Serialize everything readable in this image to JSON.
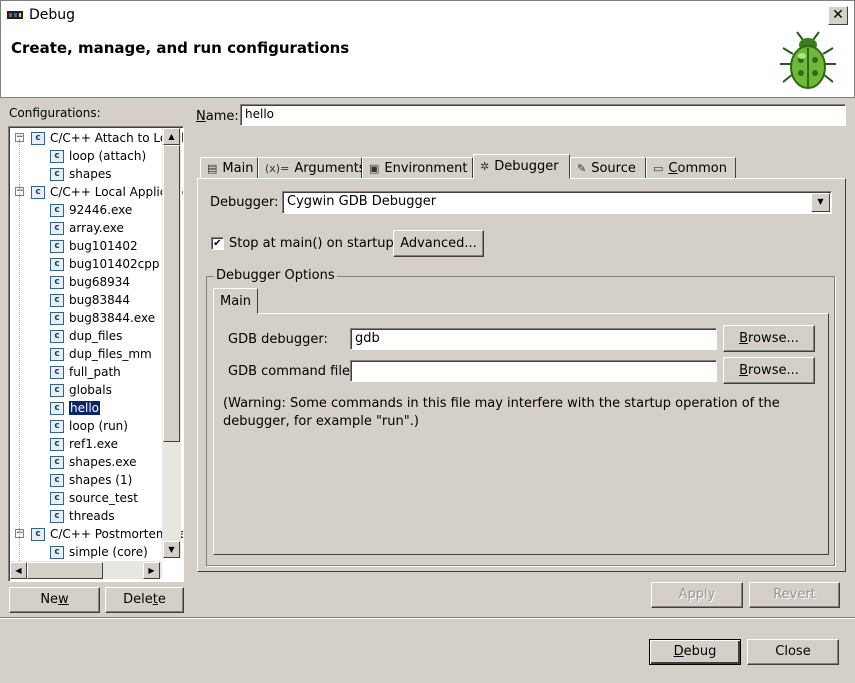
{
  "window": {
    "title": "Debug",
    "close_glyph": "✕"
  },
  "header": {
    "title": "Create, manage, and run configurations",
    "icon": "bug-icon"
  },
  "configurations": {
    "label": "Configurations:",
    "tree": [
      {
        "type": "group",
        "label": "C/C++ Attach to Local Application",
        "expanded": true
      },
      {
        "type": "item",
        "label": "loop (attach)"
      },
      {
        "type": "item",
        "label": "shapes"
      },
      {
        "type": "group",
        "label": "C/C++ Local Application",
        "expanded": true
      },
      {
        "type": "item",
        "label": "92446.exe"
      },
      {
        "type": "item",
        "label": "array.exe"
      },
      {
        "type": "item",
        "label": "bug101402"
      },
      {
        "type": "item",
        "label": "bug101402cpp"
      },
      {
        "type": "item",
        "label": "bug68934"
      },
      {
        "type": "item",
        "label": "bug83844"
      },
      {
        "type": "item",
        "label": "bug83844.exe"
      },
      {
        "type": "item",
        "label": "dup_files"
      },
      {
        "type": "item",
        "label": "dup_files_mm"
      },
      {
        "type": "item",
        "label": "full_path"
      },
      {
        "type": "item",
        "label": "globals"
      },
      {
        "type": "item",
        "label": "hello",
        "selected": true
      },
      {
        "type": "item",
        "label": "loop (run)"
      },
      {
        "type": "item",
        "label": "ref1.exe"
      },
      {
        "type": "item",
        "label": "shapes.exe"
      },
      {
        "type": "item",
        "label": "shapes (1)"
      },
      {
        "type": "item",
        "label": "source_test"
      },
      {
        "type": "item",
        "label": "threads"
      },
      {
        "type": "group",
        "label": "C/C++ Postmortem debugger",
        "expanded": true
      },
      {
        "type": "item",
        "label": "simple (core)"
      }
    ],
    "new_prefix": "Ne",
    "new_u": "w",
    "new_rest": "",
    "delete_prefix": "Dele",
    "delete_u": "t",
    "delete_rest": "e"
  },
  "name": {
    "label_u": "N",
    "label_rest": "ame:",
    "value": "hello"
  },
  "tabs": [
    {
      "label": "Main",
      "icon": "page-icon",
      "glyph": "▤",
      "u": ""
    },
    {
      "label": "Arguments",
      "icon": "arguments-icon",
      "glyph": "(x)=",
      "u": ""
    },
    {
      "label": "Environment",
      "icon": "environment-icon",
      "glyph": "▣",
      "u": ""
    },
    {
      "label": "Debugger",
      "icon": "bug-small-icon",
      "glyph": "✲",
      "u": "",
      "active": true
    },
    {
      "label": "Source",
      "icon": "source-icon",
      "glyph": "✎",
      "u": ""
    },
    {
      "label": "Common",
      "icon": "common-icon",
      "glyph": "▭",
      "u": "C"
    }
  ],
  "debugger": {
    "label": "Debugger:",
    "selected": "Cygwin GDB Debugger",
    "stop_at_main_label": "Stop at main() on startup",
    "stop_at_main_checked": true,
    "advanced_label": "Advanced..."
  },
  "options": {
    "group_label": "Debugger Options",
    "tab_label": "Main",
    "gdb_label": "GDB debugger:",
    "gdb_value": "gdb",
    "cmdfile_label": "GDB command file:",
    "cmdfile_value": "",
    "browse_u": "B",
    "browse_rest": "rowse...",
    "warning": "(Warning: Some commands in this file may interfere with the startup operation of the debugger, for example \"run\".)"
  },
  "actions": {
    "apply": "Apply",
    "revert": "Revert",
    "debug_u": "D",
    "debug_rest": "ebug",
    "close": "Close"
  },
  "colors": {
    "selection": "#0a246a",
    "face": "#d4d0c8"
  }
}
